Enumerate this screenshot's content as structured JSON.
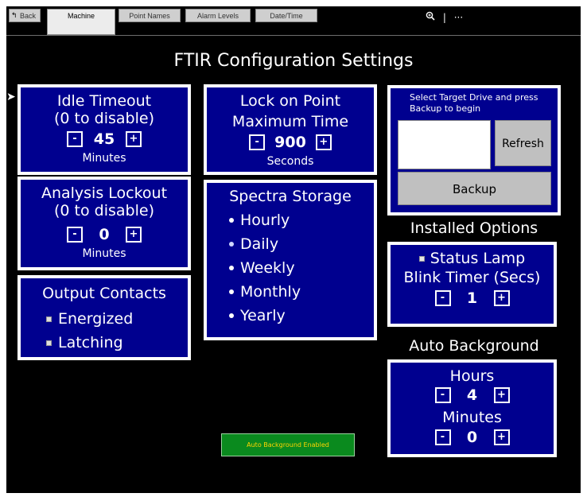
{
  "tabs": {
    "back": "Back",
    "machine": "Machine",
    "point_names": "Point Names",
    "alarm_levels": "Alarm Levels",
    "date_time": "Date/Time"
  },
  "toolbar": {
    "zoom_icon": "zoom-icon",
    "separator": "|",
    "more": "···"
  },
  "title": "FTIR Configuration Settings",
  "idle_timeout": {
    "line1": "Idle Timeout",
    "line2": "(0 to disable)",
    "value": "45",
    "unit": "Minutes",
    "minus": "-",
    "plus": "+"
  },
  "analysis_lockout": {
    "line1": "Analysis Lockout",
    "line2": "(0 to disable)",
    "value": "0",
    "unit": "Minutes",
    "minus": "-",
    "plus": "+"
  },
  "output_contacts": {
    "title": "Output Contacts",
    "items": [
      "Energized",
      "Latching"
    ]
  },
  "lock_on_point": {
    "line1": "Lock on Point",
    "line2": "Maximum Time",
    "value": "900",
    "unit": "Seconds",
    "minus": "-",
    "plus": "+"
  },
  "spectra_storage": {
    "title": "Spectra Storage",
    "items": [
      "Hourly",
      "Daily",
      "Weekly",
      "Monthly",
      "Yearly"
    ]
  },
  "backup": {
    "prompt": "Select Target Drive and press Backup to begin",
    "refresh": "Refresh",
    "backup": "Backup"
  },
  "installed_options": {
    "title": "Installed Options",
    "status_lamp": "Status Lamp",
    "blink_timer": "Blink Timer (Secs)",
    "value": "1",
    "minus": "-",
    "plus": "+"
  },
  "auto_background": {
    "title": "Auto Background",
    "hours_label": "Hours",
    "hours_value": "4",
    "minutes_label": "Minutes",
    "minutes_value": "0",
    "minus": "-",
    "plus": "+",
    "status": "Auto Background Enabled"
  },
  "colors": {
    "panel": "#00008f",
    "border": "#ffffff",
    "status_bg": "#0a8a1e",
    "status_text": "#ffd400"
  }
}
